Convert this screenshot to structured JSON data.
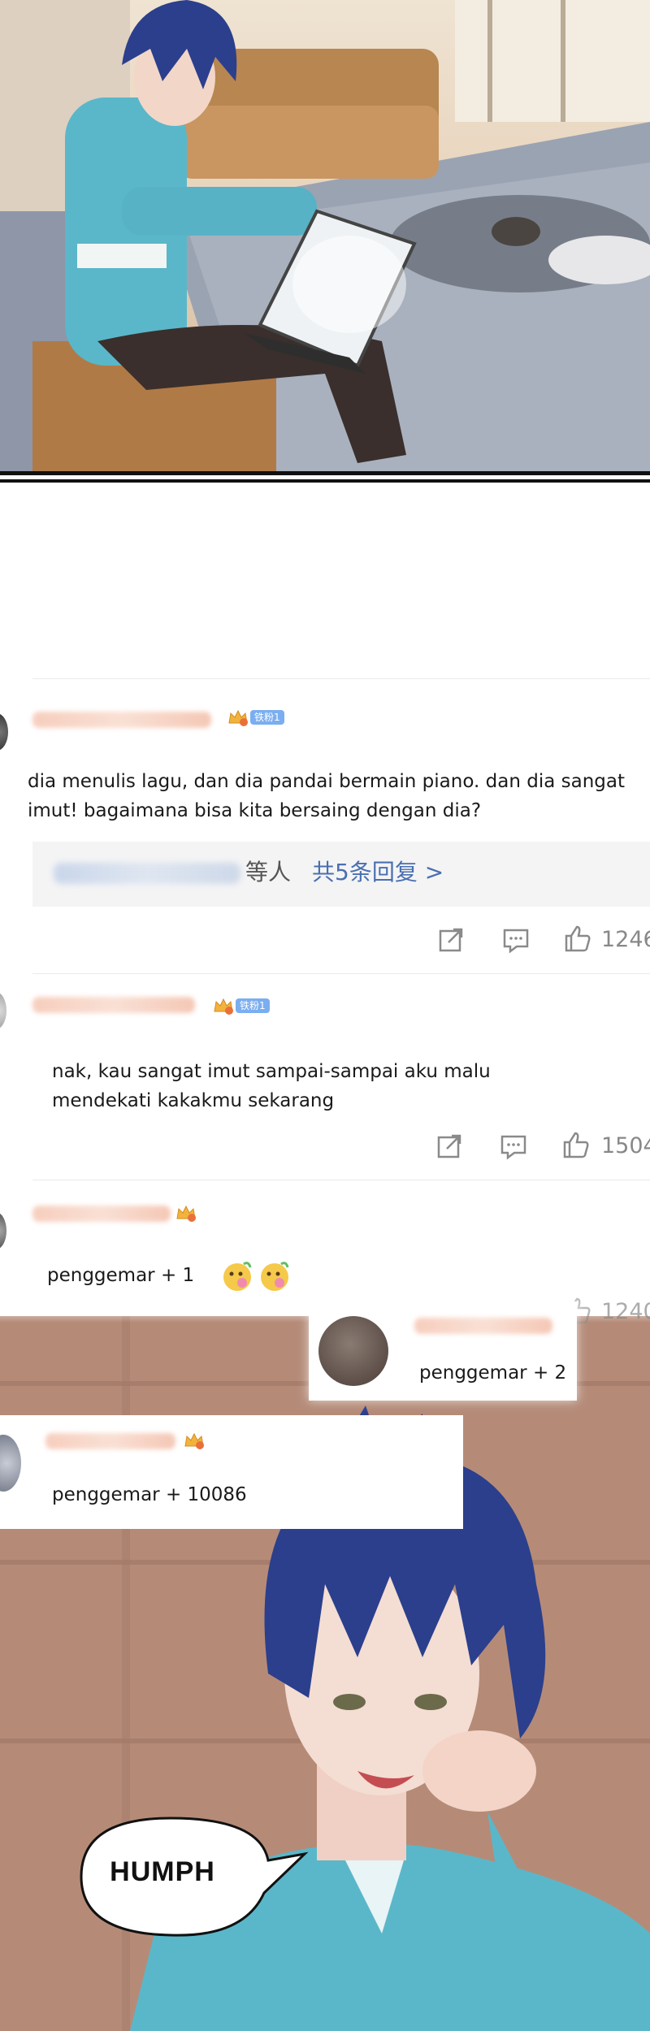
{
  "comments": [
    {
      "fan_badge": "铁粉1",
      "text_lines": [
        "dia menulis lagu, dan dia pandai bermain piano. dan dia sangat",
        "imut! bagaimana bisa kita bersaing dengan dia?"
      ],
      "reply_prefix": "等人",
      "reply_link": "共5条回复 >",
      "likes": "1246"
    },
    {
      "fan_badge": "铁粉1",
      "text_lines": [
        "nak, kau sangat imut sampai-sampai aku malu",
        "mendekati kakakmu sekarang"
      ],
      "likes": "1504"
    },
    {
      "text": "penggemar + 1",
      "likes": "1240"
    },
    {
      "text": "penggemar + 2"
    },
    {
      "text": "penggemar + 10086"
    }
  ],
  "speech_bubble": {
    "text": "HUMPH"
  },
  "colors": {
    "fan_tag": "#7aaef0",
    "reply_link": "#4a6fb0",
    "icon_gray": "#8a8a8a",
    "hair": "#2b3f8c",
    "shirt": "#5ab7c9"
  },
  "icons": [
    "share-icon",
    "comment-icon",
    "like-icon",
    "crown-badge-icon",
    "emoji-flower-icon"
  ]
}
